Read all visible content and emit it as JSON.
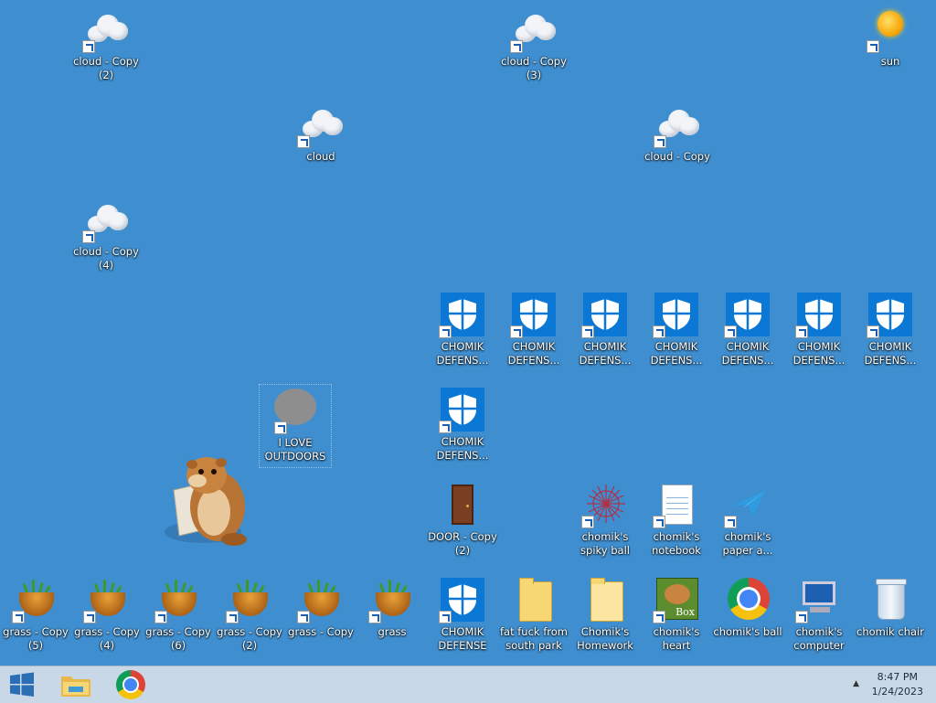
{
  "desktop": {
    "icons": {
      "cloud_copy_2": "cloud - Copy (2)",
      "cloud_copy_3": "cloud - Copy (3)",
      "sun": "sun",
      "cloud": "cloud",
      "cloud_copy": "cloud - Copy",
      "cloud_copy_4": "cloud - Copy (4)",
      "defense_1": "CHOMIK DEFENS...",
      "defense_2": "CHOMIK DEFENS...",
      "defense_3": "CHOMIK DEFENS...",
      "defense_4": "CHOMIK DEFENS...",
      "defense_5": "CHOMIK DEFENS...",
      "defense_6": "CHOMIK DEFENS...",
      "defense_7": "CHOMIK DEFENS...",
      "defense_8": "CHOMIK DEFENS...",
      "i_love_outdoors": "I LOVE OUTDOORS",
      "door_copy_2": "DOOR - Copy (2)",
      "spiky_ball": "chomik's spiky ball",
      "notebook": "chomik's notebook",
      "paper_airplane": "chomik's paper a...",
      "grass_copy_5": "grass - Copy (5)",
      "grass_copy_4": "grass - Copy (4)",
      "grass_copy_6": "grass - Copy (6)",
      "grass_copy_2": "grass - Copy (2)",
      "grass_copy": "grass - Copy",
      "grass": "grass",
      "defense_main": "CHOMIK DEFENSE",
      "south_park": "fat fuck from south park",
      "homework": "Chomik's Homework",
      "heart": "chomik's heart",
      "ball": "chomik's ball",
      "computer": "chomik's computer",
      "chair": "chomik chair"
    },
    "heart_box_text": "Box"
  },
  "taskbar": {
    "start_icon": "windows-logo-icon",
    "pinned": [
      "file-explorer-icon",
      "chrome-icon"
    ],
    "time": "8:47 PM",
    "date": "1/24/2023"
  },
  "colors": {
    "desktop_bg": "#3f8fd0",
    "shield_tile": "#0a78d4",
    "taskbar_bg": "#c9d8e6"
  }
}
